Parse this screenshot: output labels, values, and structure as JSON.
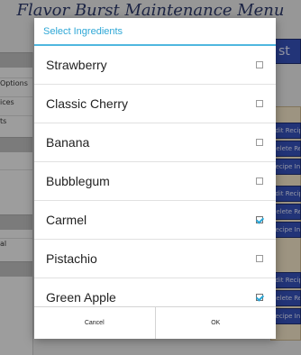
{
  "background_app": {
    "title": "Flavor Burst Maintenance Menu",
    "left_panel": {
      "items": [
        "Options",
        "ices",
        "ts",
        "",
        "",
        "",
        "al"
      ]
    },
    "right_panel": {
      "top_button_label": "st",
      "buttons": [
        "Edit Recipe",
        "Delete Recipe",
        "Recipe Ingredients",
        "Edit Recipe",
        "Delete Recipe",
        "Recipe Ingredients",
        "Edit Recipe",
        "Delete Recipe",
        "Recipe Ingredients"
      ]
    }
  },
  "dialog": {
    "title": "Select Ingredients",
    "items": [
      {
        "label": "Strawberry",
        "checked": false
      },
      {
        "label": "Classic Cherry",
        "checked": false
      },
      {
        "label": "Banana",
        "checked": false
      },
      {
        "label": "Bubblegum",
        "checked": false
      },
      {
        "label": "Carmel",
        "checked": true
      },
      {
        "label": "Pistachio",
        "checked": false
      },
      {
        "label": "Green Apple",
        "checked": true
      }
    ],
    "buttons": {
      "cancel": "Cancel",
      "ok": "OK"
    }
  },
  "colors": {
    "accent": "#2ea7d6",
    "app_button": "#3550b8",
    "app_title": "#2d3a6a"
  }
}
